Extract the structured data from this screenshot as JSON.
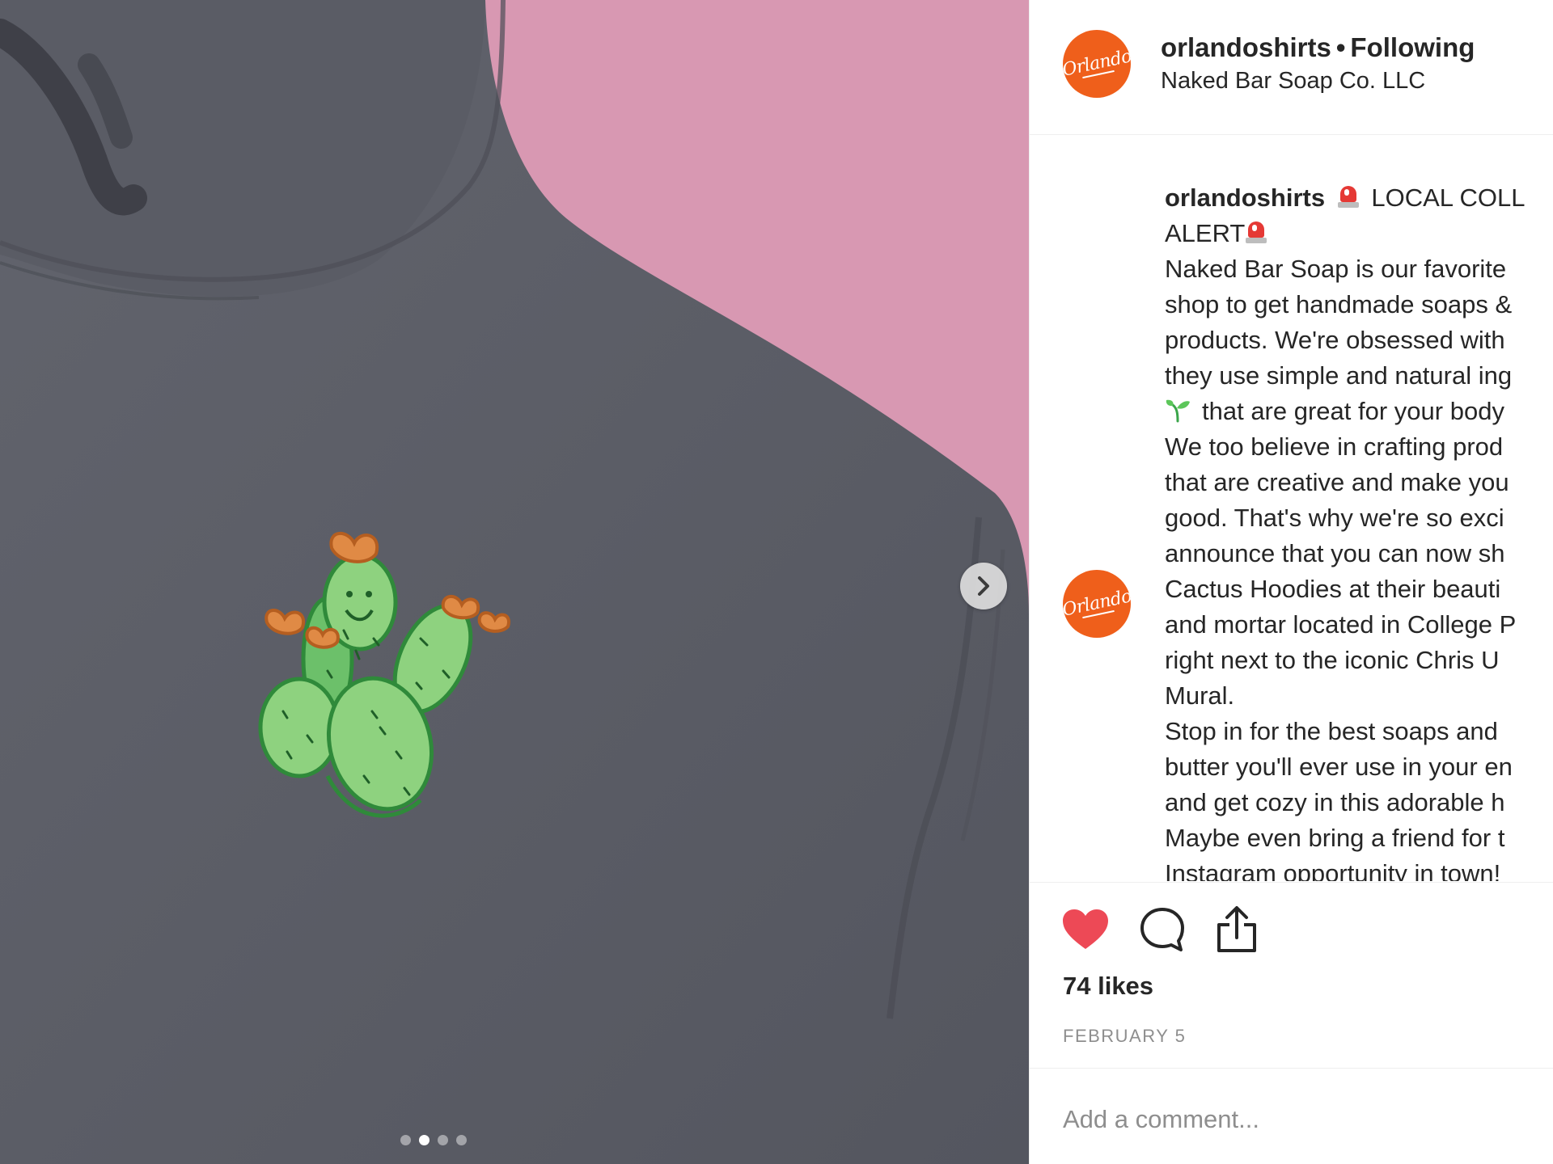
{
  "post": {
    "author": {
      "username": "orlandoshirts",
      "follow_status": "Following",
      "separator": "•",
      "avatar_text": "Orlando"
    },
    "location": "Naked Bar Soap Co. LLC",
    "media": {
      "icon": "chevron-right-icon",
      "carousel_count": 4,
      "carousel_active": 2
    },
    "caption": {
      "username": "orlandoshirts",
      "line1_text": "LOCAL COLL",
      "line2_text": "ALERT",
      "line4": "shop to get handmade soaps &",
      "line5": "products. We're obsessed with",
      "line6": "they use simple and natural ing",
      "line7_text": "that are great for your body",
      "line8": "We too believe in crafting prod",
      "line9": "that are creative and make you",
      "line10": "good. That's why we're so exci",
      "line11": "announce that you can now sh",
      "line12": "Cactus Hoodies at their beauti",
      "line13": "and mortar located in College P",
      "line14": "right next to the iconic Chris U",
      "line15": "Mural.",
      "line16": "Stop in for the best soaps and",
      "line17": "butter you'll ever use in your en",
      "line18": "and get cozy in this adorable h",
      "line19": "Maybe even bring a friend for t",
      "line20": "Instagram opportunity in town!",
      "line3": "Naked Bar Soap is our favorite",
      "emoji_icons": [
        "rotating-light-icon",
        "seedling-icon"
      ]
    },
    "actions": {
      "liked": true,
      "like_color": "#ed4956",
      "icons": [
        "heart-icon",
        "comment-icon",
        "share-icon"
      ]
    },
    "likes": "74 likes",
    "date": "FEBRUARY 5",
    "comment": {
      "placeholder": "Add a comment...",
      "value": ""
    },
    "colors": {
      "brand_orange": "#ef5f1b",
      "text": "#262626",
      "muted": "#8e8e8e",
      "photo_background": "#d898b2",
      "hoodie": "#5b5d66"
    }
  }
}
